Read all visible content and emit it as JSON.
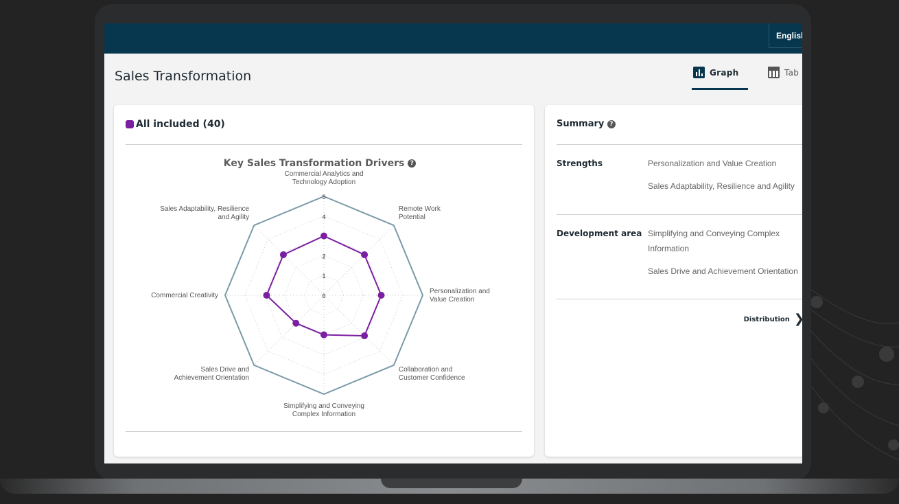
{
  "topbar": {
    "language": "English"
  },
  "page": {
    "title": "Sales Transformation"
  },
  "view_tabs": [
    {
      "label": "Graph",
      "icon": "bar-chart-icon",
      "active": true
    },
    {
      "label": "Tab",
      "icon": "table-icon",
      "active": false
    }
  ],
  "chart_card": {
    "legend_label": "All included (40)",
    "legend_color": "#7b1fa2",
    "chart_title": "Key Sales Transformation Drivers"
  },
  "chart_data": {
    "type": "radar",
    "title": "Key Sales Transformation Drivers",
    "categories": [
      "Commercial Analytics and Technology Adoption",
      "Remote Work Potential",
      "Personalization and Value Creation",
      "Collaboration and Customer Confidence",
      "Simplifying and Conveying Complex Information",
      "Sales Drive and Achievement Orientation",
      "Commercial Creativity",
      "Sales Adaptability, Resilience and Agility"
    ],
    "category_lines": [
      [
        "Commercial Analytics and",
        "Technology Adoption"
      ],
      [
        "Remote Work",
        "Potential"
      ],
      [
        "Personalization and",
        "Value Creation"
      ],
      [
        "Collaboration and",
        "Customer Confidence"
      ],
      [
        "Simplifying and Conveying",
        "Complex Information"
      ],
      [
        "Sales Drive and",
        "Achievement Orientation"
      ],
      [
        "Commercial Creativity"
      ],
      [
        "Sales Adaptability, Resilience",
        "and Agility"
      ]
    ],
    "ticks": [
      "0",
      "1",
      "2",
      "4",
      "5"
    ],
    "tick_values": [
      0,
      1,
      2,
      4,
      5
    ],
    "range": [
      0,
      5
    ],
    "series": [
      {
        "name": "All included (40)",
        "color": "#7b1fa2",
        "values": [
          3.0,
          2.9,
          2.9,
          2.9,
          2.0,
          2.0,
          2.9,
          2.9
        ]
      }
    ],
    "outline_color": "#7a9aa8"
  },
  "summary": {
    "title": "Summary",
    "strengths_label": "Strengths",
    "strengths": [
      "Personalization and Value Creation",
      "Sales Adaptability, Resilience and Agility"
    ],
    "development_label": "Development area",
    "development": [
      "Simplifying and Conveying Complex Information",
      "Sales Drive and Achievement Orientation"
    ],
    "distribution_link": "Distribution"
  }
}
